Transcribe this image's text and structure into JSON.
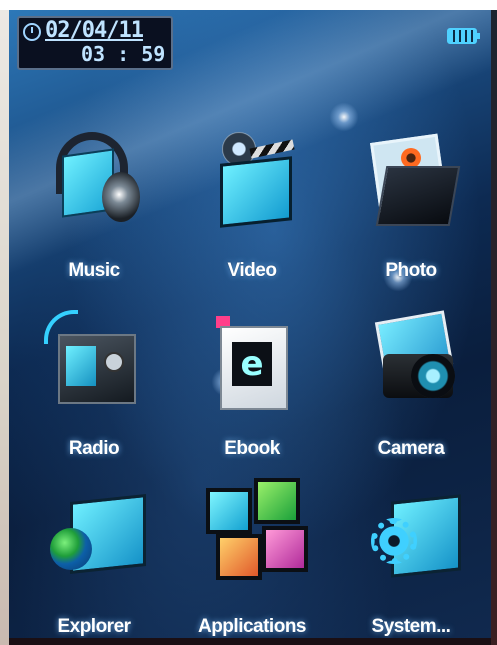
{
  "status_bar": {
    "date": "02/04/11",
    "time": "03 : 59",
    "battery_icon": "battery-full-icon"
  },
  "apps": [
    {
      "label": "Music",
      "icon": "music-headphones-icon"
    },
    {
      "label": "Video",
      "icon": "video-film-icon"
    },
    {
      "label": "Photo",
      "icon": "photo-album-icon"
    },
    {
      "label": "Radio",
      "icon": "radio-icon"
    },
    {
      "label": "Ebook",
      "icon": "ebook-icon"
    },
    {
      "label": "Camera",
      "icon": "camera-icon"
    },
    {
      "label": "Explorer",
      "icon": "explorer-globe-icon"
    },
    {
      "label": "Applications",
      "icon": "applications-tiles-icon"
    },
    {
      "label": "System...",
      "icon": "system-gear-icon"
    }
  ],
  "theme": {
    "background": "#0d2a52",
    "accent": "#6ff0ff",
    "label_color": "#ffffff"
  }
}
